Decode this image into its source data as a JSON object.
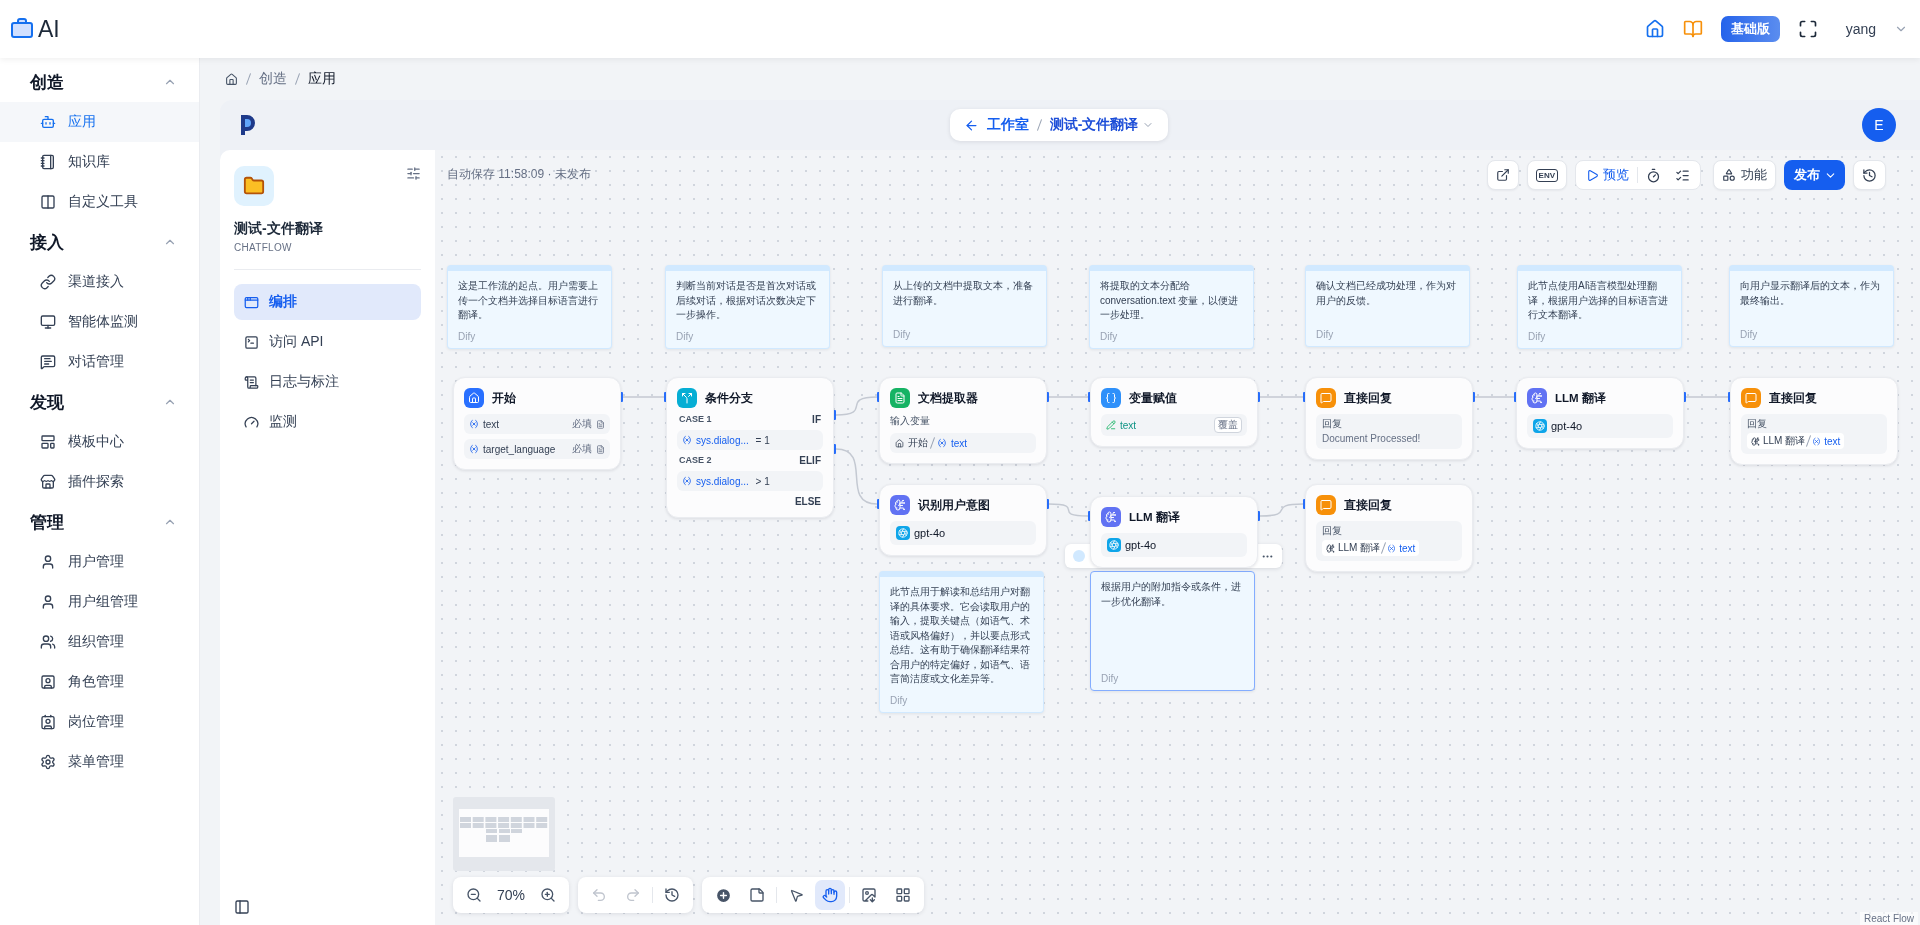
{
  "header": {
    "brand": "AI",
    "plan_badge": "基础版",
    "user": "yang"
  },
  "sidebar": {
    "sections": [
      {
        "title": "创造",
        "expanded": true,
        "items": [
          {
            "label": "应用",
            "selected": true
          },
          {
            "label": "知识库",
            "selected": false
          },
          {
            "label": "自定义工具",
            "selected": false
          }
        ]
      },
      {
        "title": "接入",
        "expanded": true,
        "items": [
          {
            "label": "渠道接入",
            "selected": false
          },
          {
            "label": "智能体监测",
            "selected": false
          },
          {
            "label": "对话管理",
            "selected": false
          }
        ]
      },
      {
        "title": "发现",
        "expanded": true,
        "items": [
          {
            "label": "模板中心",
            "selected": false
          },
          {
            "label": "插件探索",
            "selected": false
          }
        ]
      },
      {
        "title": "管理",
        "expanded": true,
        "items": [
          {
            "label": "用户管理",
            "selected": false
          },
          {
            "label": "用户组管理",
            "selected": false
          },
          {
            "label": "组织管理",
            "selected": false
          },
          {
            "label": "角色管理",
            "selected": false
          },
          {
            "label": "岗位管理",
            "selected": false
          },
          {
            "label": "菜单管理",
            "selected": false
          }
        ]
      }
    ]
  },
  "breadcrumb": [
    "创造",
    "应用"
  ],
  "workspace_bar": {
    "back": "工作室",
    "app_name": "测试-文件翻译",
    "avatar": "E"
  },
  "app": {
    "title": "测试-文件翻译",
    "mode": "CHATFLOW",
    "nav": [
      {
        "label": "编排",
        "selected": true
      },
      {
        "label": "访问 API",
        "selected": false
      },
      {
        "label": "日志与标注",
        "selected": false
      },
      {
        "label": "监测",
        "selected": false
      }
    ]
  },
  "canvas_toolbar": {
    "status": "自动保存 11:58:09 · 未发布",
    "env": "ENV",
    "preview": "预览",
    "features": "功能",
    "publish": "发布"
  },
  "notes": [
    {
      "text": "这是工作流的起点。用户需要上传一个文档并选择目标语言进行翻译。",
      "author": "Dify",
      "selected": false
    },
    {
      "text": "判断当前对话是否是首次对话或后续对话，根据对话次数决定下一步操作。",
      "author": "Dify",
      "selected": false
    },
    {
      "text": "从上传的文档中提取文本，准备进行翻译。",
      "author": "Dify",
      "selected": false
    },
    {
      "text": "将提取的文本分配给 conversation.text 变量，以便进一步处理。",
      "author": "Dify",
      "selected": false
    },
    {
      "text": "确认文档已经成功处理，作为对用户的反馈。",
      "author": "Dify",
      "selected": false
    },
    {
      "text": "此节点使用AI语言模型处理翻译，根据用户选择的目标语言进行文本翻译。",
      "author": "Dify",
      "selected": false
    },
    {
      "text": "向用户显示翻译后的文本，作为最终输出。",
      "author": "Dify",
      "selected": false
    },
    {
      "text": "此节点用于解读和总结用户对翻译的具体要求。它会读取用户的输入，提取关键点（如语气、术语或风格偏好），并以要点形式总结。这有助于确保翻译结果符合用户的特定偏好，如语气、语言简洁度或文化差异等。",
      "author": "Dify",
      "selected": false
    },
    {
      "text": "根据用户的附加指令或条件，进一步优化翻译。",
      "author": "Dify",
      "selected": true
    }
  ],
  "nodes": [
    {
      "kind": "start",
      "title": "开始",
      "variables": [
        {
          "name": "text",
          "required": "必填"
        },
        {
          "name": "target_language",
          "required": "必填"
        }
      ]
    },
    {
      "kind": "if-else",
      "title": "条件分支",
      "cases": [
        {
          "label": "CASE 1",
          "branch": "IF",
          "variable": "sys.dialog...",
          "condition": "= 1"
        },
        {
          "label": "CASE 2",
          "branch": "ELIF",
          "variable": "sys.dialog...",
          "condition": "> 1"
        }
      ],
      "else": "ELSE"
    },
    {
      "kind": "document-extractor",
      "title": "文档提取器",
      "input_label": "输入变量",
      "source_node": "开始",
      "source_var": "text"
    },
    {
      "kind": "assigner",
      "title": "变量赋值",
      "variable": "text",
      "mode": "覆盖"
    },
    {
      "kind": "answer",
      "title": "直接回复",
      "reply_label": "回复",
      "reply_text": "Document Processed!"
    },
    {
      "kind": "llm",
      "title": "LLM 翻译",
      "model": "gpt-4o"
    },
    {
      "kind": "answer",
      "title": "直接回复",
      "reply_label": "回复",
      "source_node": "LLM 翻译",
      "source_var": "text"
    },
    {
      "kind": "llm",
      "title": "识别用户意图",
      "model": "gpt-4o"
    },
    {
      "kind": "llm",
      "title": "LLM 翻译",
      "model": "gpt-4o"
    },
    {
      "kind": "answer",
      "title": "直接回复",
      "reply_label": "回复",
      "source_node": "LLM 翻译",
      "source_var": "text"
    }
  ],
  "zoom": "70%",
  "attribution": "React Flow"
}
